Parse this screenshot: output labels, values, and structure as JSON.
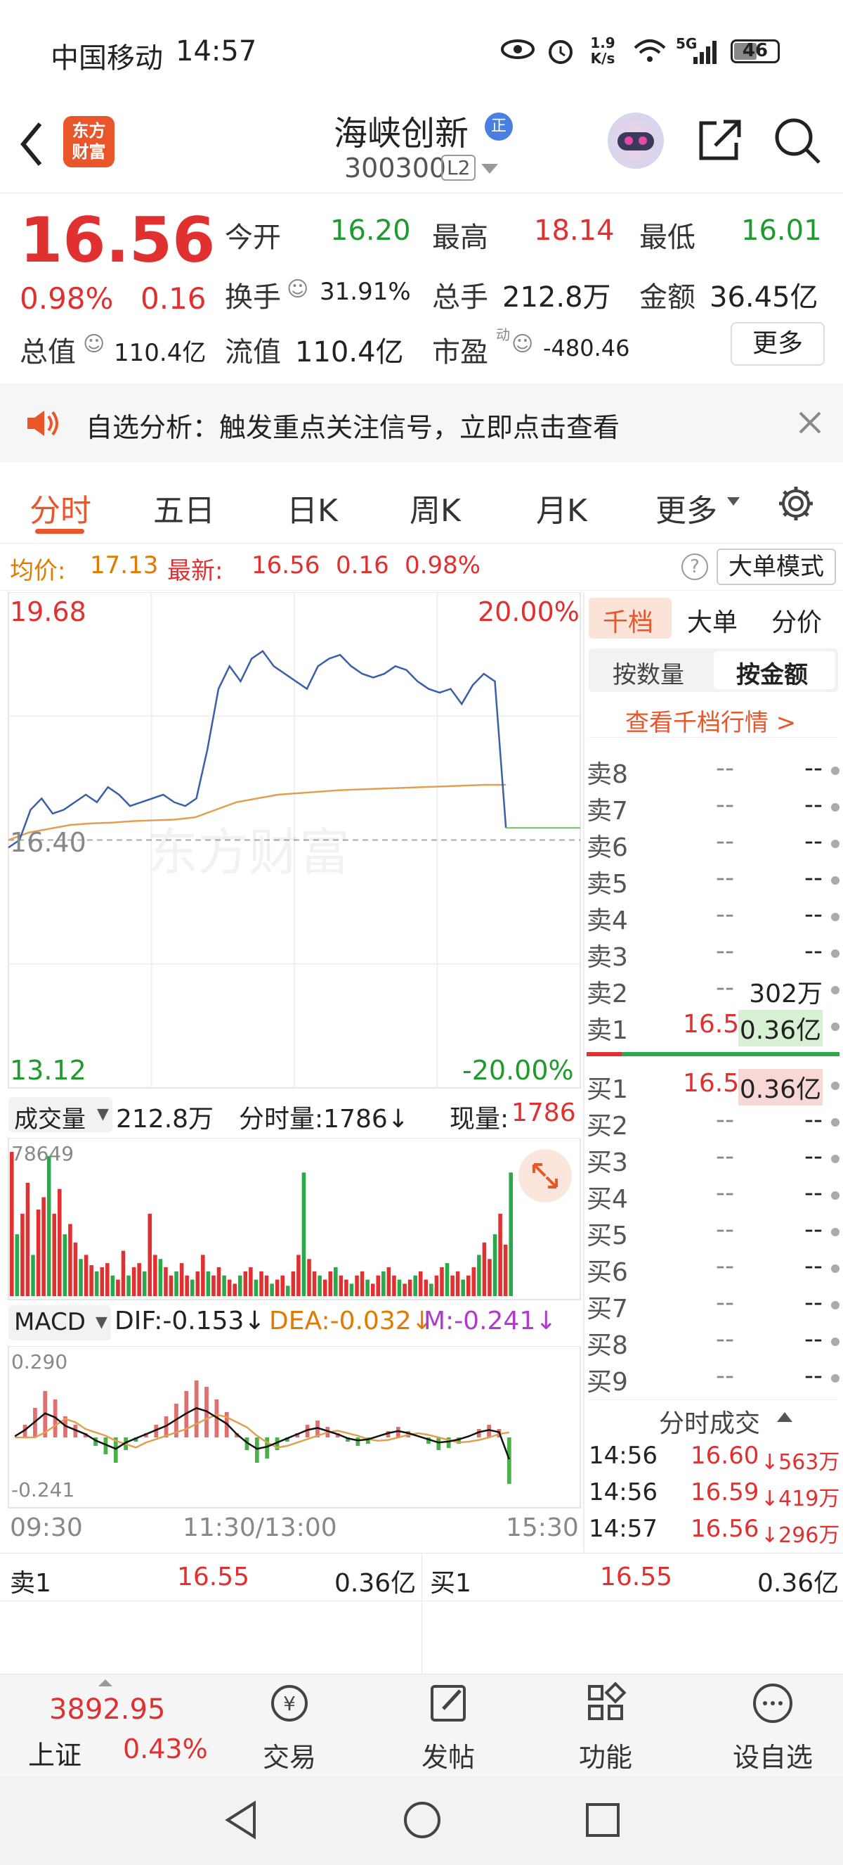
{
  "status_bar": {
    "carrier": "中国移动",
    "time": "14:57",
    "net_speed": "1.9 K/s",
    "signal": "5G",
    "battery": "46"
  },
  "header": {
    "stock_name": "海峡创新",
    "badge": "正",
    "code": "300300",
    "level": "L2",
    "logo_text_1": "东方",
    "logo_text_2": "财富"
  },
  "quote": {
    "price": "16.56",
    "change_pct": "0.98%",
    "change_amt": "0.16",
    "open_label": "今开",
    "open": "16.20",
    "high_label": "最高",
    "high": "18.14",
    "low_label": "最低",
    "low": "16.01",
    "turnover_label": "换手",
    "turnover": "31.91%",
    "volume_label": "总手",
    "volume": "212.8万",
    "amount_label": "金额",
    "amount": "36.45亿",
    "mktcap_label": "总值",
    "mktcap": "110.4亿",
    "float_label": "流值",
    "float_cap": "110.4亿",
    "pe_label": "市盈",
    "pe_sup": "动",
    "pe": "-480.46",
    "more_label": "更多"
  },
  "banner": {
    "text": "自选分析：触发重点关注信号，立即点击查看"
  },
  "tabs": [
    "分时",
    "五日",
    "日K",
    "周K",
    "月K",
    "更多"
  ],
  "active_tab": "分时",
  "infobar": {
    "avg_label": "均价:",
    "avg": "17.13",
    "latest_label": "最新:",
    "latest": "16.56",
    "chg": "0.16",
    "pct": "0.98%",
    "big_order": "大单模式"
  },
  "chart": {
    "y_top": "19.68",
    "y_mid": "16.40",
    "y_bottom": "13.12",
    "pct_top": "20.00%",
    "pct_bottom": "-20.00%",
    "t_start": "09:30",
    "t_mid": "11:30/13:00",
    "t_end": "15:30",
    "watermark": "东方财富"
  },
  "chart_data": {
    "type": "line",
    "x_labels": [
      "09:30",
      "11:30/13:00",
      "15:30"
    ],
    "ylim": [
      13.12,
      19.68
    ],
    "prev_close": 16.4,
    "series": [
      {
        "values": [
          16.3,
          16.4,
          16.8,
          16.95,
          16.75,
          16.8,
          16.9,
          17.0,
          16.9,
          17.1,
          17.0,
          16.85,
          16.9,
          16.95,
          17.0,
          16.9,
          16.85,
          16.95,
          17.6,
          18.4,
          18.7,
          18.5,
          18.8,
          18.9,
          18.7,
          18.6,
          18.5,
          18.4,
          18.7,
          18.8,
          18.85,
          18.7,
          18.6,
          18.55,
          18.6,
          18.7,
          18.65,
          18.5,
          18.4,
          18.35,
          18.4,
          18.2,
          18.45,
          18.6,
          18.5,
          16.56
        ]
      },
      {
        "values": [
          16.4,
          16.5,
          16.55,
          16.6,
          16.62,
          16.63,
          16.65,
          16.66,
          16.67,
          16.7,
          16.8,
          16.9,
          16.95,
          17.0,
          17.02,
          17.04,
          17.06,
          17.07,
          17.08,
          17.09,
          17.1,
          17.11,
          17.12,
          17.13,
          17.13
        ]
      }
    ]
  },
  "volume": {
    "label": "成交量",
    "total": "212.8万",
    "tick_label": "分时量:1786↓",
    "now_label": "现量:",
    "now": "1786",
    "max": "78649"
  },
  "volume_data": [
    70,
    30,
    40,
    55,
    20,
    42,
    48,
    68,
    40,
    52,
    30,
    35,
    26,
    18,
    20,
    15,
    12,
    14,
    16,
    10,
    8,
    22,
    10,
    14,
    16,
    12,
    40,
    20,
    18,
    14,
    10,
    12,
    16,
    10,
    8,
    12,
    20,
    12,
    10,
    14,
    10,
    8,
    6,
    10,
    12,
    14,
    8,
    12,
    10,
    6,
    8,
    10,
    5,
    12,
    20,
    60,
    18,
    12,
    10,
    8,
    12,
    14,
    10,
    8,
    6,
    10,
    12,
    8,
    6,
    10,
    12,
    14,
    10,
    8,
    6,
    8,
    10,
    12,
    8,
    6,
    10,
    14,
    16,
    10,
    12,
    8,
    10,
    14,
    20,
    26,
    18,
    30,
    40,
    25,
    60
  ],
  "macd": {
    "label": "MACD",
    "dif": "DIF:-0.153↓",
    "dea": "DEA:-0.032↓",
    "m": "M:-0.241↓",
    "top": "0.290",
    "bottom": "-0.241"
  },
  "macd_data": [
    0.0,
    0.06,
    0.14,
    0.22,
    0.18,
    0.1,
    0.06,
    0.02,
    -0.04,
    -0.08,
    -0.12,
    -0.06,
    -0.02,
    0.02,
    0.06,
    0.1,
    0.16,
    0.22,
    0.27,
    0.24,
    0.18,
    0.12,
    0.02,
    -0.06,
    -0.12,
    -0.1,
    -0.06,
    -0.02,
    0.02,
    0.06,
    0.08,
    0.05,
    0.02,
    -0.02,
    -0.04,
    -0.03,
    0.0,
    0.03,
    0.05,
    0.03,
    0.0,
    -0.03,
    -0.06,
    -0.05,
    -0.03,
    0.0,
    0.04,
    0.06,
    0.04,
    -0.22
  ],
  "orderbook": {
    "tabs": [
      "千档",
      "大单",
      "分价"
    ],
    "modes": [
      "按数量",
      "按金额"
    ],
    "link": "查看千档行情 >",
    "asks": [
      {
        "k": "卖8",
        "p": "--",
        "v": "--"
      },
      {
        "k": "卖7",
        "p": "--",
        "v": "--"
      },
      {
        "k": "卖6",
        "p": "--",
        "v": "--"
      },
      {
        "k": "卖5",
        "p": "--",
        "v": "--"
      },
      {
        "k": "卖4",
        "p": "--",
        "v": "--"
      },
      {
        "k": "卖3",
        "p": "--",
        "v": "--"
      },
      {
        "k": "卖2",
        "p": "--",
        "v": "302万"
      },
      {
        "k": "卖1",
        "p": "16.55",
        "v": "0.36亿"
      }
    ],
    "bids": [
      {
        "k": "买1",
        "p": "16.55",
        "v": "0.36亿"
      },
      {
        "k": "买2",
        "p": "--",
        "v": "--"
      },
      {
        "k": "买3",
        "p": "--",
        "v": "--"
      },
      {
        "k": "买4",
        "p": "--",
        "v": "--"
      },
      {
        "k": "买5",
        "p": "--",
        "v": "--"
      },
      {
        "k": "买6",
        "p": "--",
        "v": "--"
      },
      {
        "k": "买7",
        "p": "--",
        "v": "--"
      },
      {
        "k": "买8",
        "p": "--",
        "v": "--"
      },
      {
        "k": "买9",
        "p": "--",
        "v": "--"
      }
    ],
    "trades_title": "分时成交",
    "trades": [
      {
        "t": "14:56",
        "p": "16.60",
        "v": "↓563万"
      },
      {
        "t": "14:56",
        "p": "16.59",
        "v": "↓419万"
      },
      {
        "t": "14:57",
        "p": "16.56",
        "v": "↓296万"
      }
    ]
  },
  "bottom_quote": {
    "left_label": "卖1",
    "left_price": "16.55",
    "left_amt": "0.36亿",
    "right_label": "买1",
    "right_price": "16.55",
    "right_amt": "0.36亿"
  },
  "index": {
    "value": "3892.95",
    "name": "上证",
    "pct": "0.43%"
  },
  "nav": [
    "交易",
    "发帖",
    "功能",
    "设自选"
  ]
}
